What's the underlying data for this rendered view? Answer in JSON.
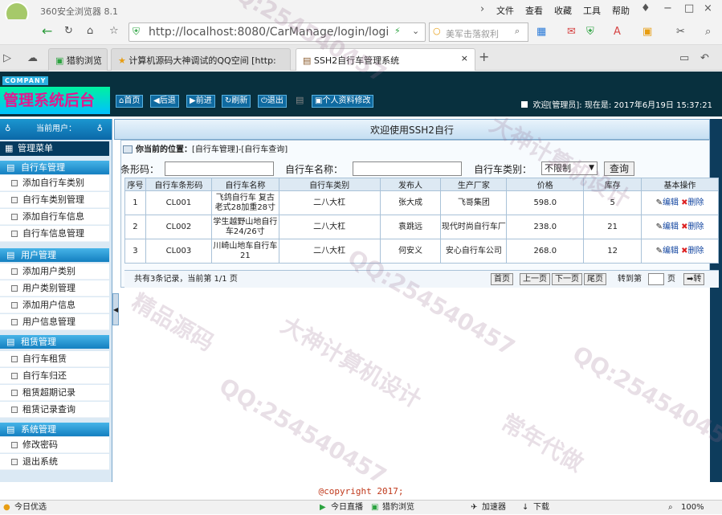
{
  "browser": {
    "title": "360安全浏览器 8.1",
    "menu": [
      "文件",
      "查看",
      "收藏",
      "工具",
      "帮助"
    ],
    "url": "http://localhost:8080/CarManage/login/logi",
    "search_text": "美军击落叙利",
    "tabs": [
      {
        "label": "猎豹浏览"
      },
      {
        "label": "计算机源码大神调试的QQ空间 [http:"
      },
      {
        "label": "SSH2自行车管理系统"
      }
    ],
    "new_tab": "+"
  },
  "app": {
    "company": "COMPANY",
    "system_name": "管理系统后台",
    "nav": [
      "首页",
      "后退",
      "前进",
      "刷新",
      "退出",
      "个人资料修改"
    ],
    "welcome": "欢迎[管理员]: 现在是: 2017年6月19日 15:37:21",
    "banner": "欢迎使用SSH2自行",
    "current_user_label": "当前用户：",
    "menu_title": "管理菜单"
  },
  "sidebar": {
    "groups": [
      {
        "title": "自行车管理",
        "items": [
          "添加自行车类别",
          "自行车类别管理",
          "添加自行车信息",
          "自行车信息管理"
        ]
      },
      {
        "title": "用户管理",
        "items": [
          "添加用户类别",
          "用户类别管理",
          "添加用户信息",
          "用户信息管理"
        ]
      },
      {
        "title": "租赁管理",
        "items": [
          "自行车租赁",
          "自行车归还",
          "租赁超期记录",
          "租赁记录查询"
        ]
      },
      {
        "title": "系统管理",
        "items": [
          "修改密码",
          "退出系统"
        ]
      }
    ]
  },
  "location": {
    "label": "你当前的位置：",
    "path": "[自行车管理]-[自行车查询]"
  },
  "filters": {
    "code_label": "条形码：",
    "name_label": "自行车名称：",
    "type_label": "自行车类别：",
    "type_value": "不限制",
    "query_button": "查询"
  },
  "table": {
    "headers": [
      "序号",
      "自行车条形码",
      "自行车名称",
      "自行车类别",
      "发布人",
      "生产厂家",
      "价格",
      "库存",
      "基本操作"
    ],
    "rows": [
      [
        "1",
        "CL001",
        "飞鸽自行车 复古老式28加重28寸",
        "二八大杠",
        "张大成",
        "飞哥集团",
        "598.0",
        "5"
      ],
      [
        "2",
        "CL002",
        "学生越野山地自行车24/26寸",
        "二八大杠",
        "袁跳远",
        "现代时尚自行车厂",
        "238.0",
        "21"
      ],
      [
        "3",
        "CL003",
        "川崎山地车自行车21",
        "二八大杠",
        "何安义",
        "安心自行车公司",
        "268.0",
        "12"
      ]
    ],
    "edit_label": "编辑",
    "delete_label": "删除"
  },
  "pager": {
    "summary": "共有3条记录，当前第 1/1 页",
    "first": "首页",
    "prev": "上一页",
    "next": "下一页",
    "last": "尾页",
    "goto_label": "转到第",
    "page_unit": "页",
    "go": "转"
  },
  "footer": {
    "copyright": "@copyright 2017;"
  },
  "statusbar": {
    "left": "今日优选",
    "live": "今日直播",
    "browse": "猎豹浏览",
    "accelerator": "加速器",
    "download": "下载",
    "zoom": "100%"
  },
  "watermark": {
    "lines": [
      "QQ:254540457",
      "大神计算机设计",
      "常年代做",
      "精品源码"
    ]
  },
  "colors": {
    "header_bg": "#08303e",
    "system_name": "#e4178f",
    "group_header": "#147fc0",
    "copyright": "#c0391b"
  }
}
